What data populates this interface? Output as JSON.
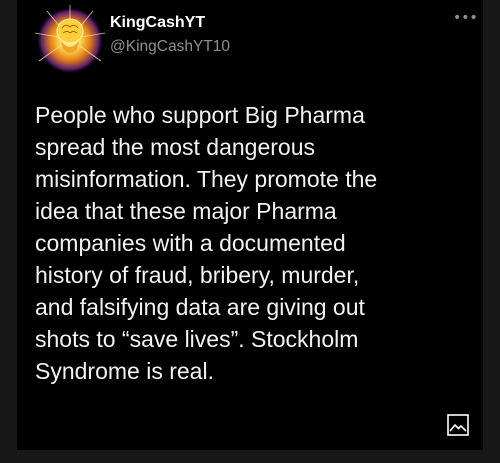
{
  "tweet": {
    "display_name": "KingCashYT",
    "handle": "@KingCashYT10",
    "text": "People who support Big Pharma\nspread the most dangerous\nmisinformation. They promote the\nidea that these major Pharma\ncompanies with a documented\nhistory of fraud, bribery, murder,\nand falsifying data are giving out\nshots to “save lives”. Stockholm\nSyndrome is real."
  },
  "icons": {
    "avatar": "avatar-glowing-brain",
    "more": "more-options-icon",
    "media": "image-media-icon"
  },
  "colors": {
    "background": "#000000",
    "text": "#f2f2f2",
    "secondary": "#8b9096"
  }
}
